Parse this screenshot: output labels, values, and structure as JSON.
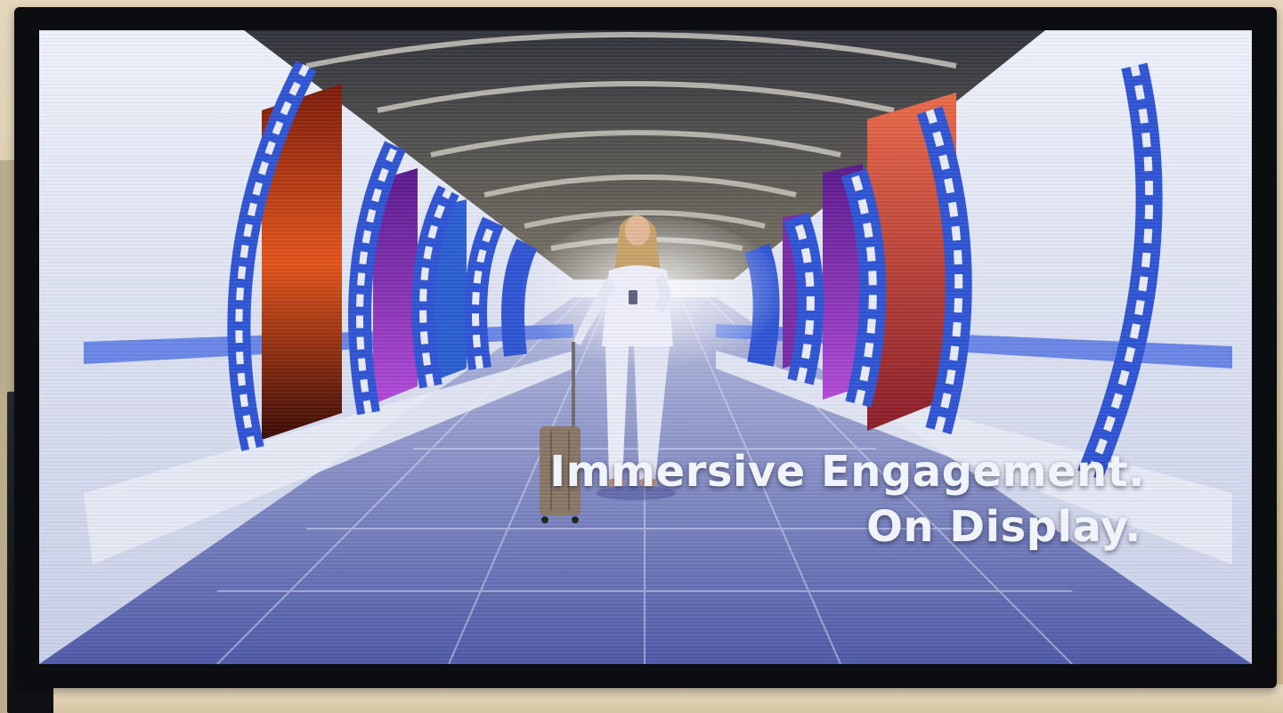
{
  "scene": {
    "description_free": true,
    "headline": {
      "line1": "Immersive Engagement.",
      "line2": "On Display."
    },
    "colors": {
      "frame_accent": "#2f55d4",
      "text": "#f1f3fb",
      "bezel": "#0c0d10"
    }
  }
}
